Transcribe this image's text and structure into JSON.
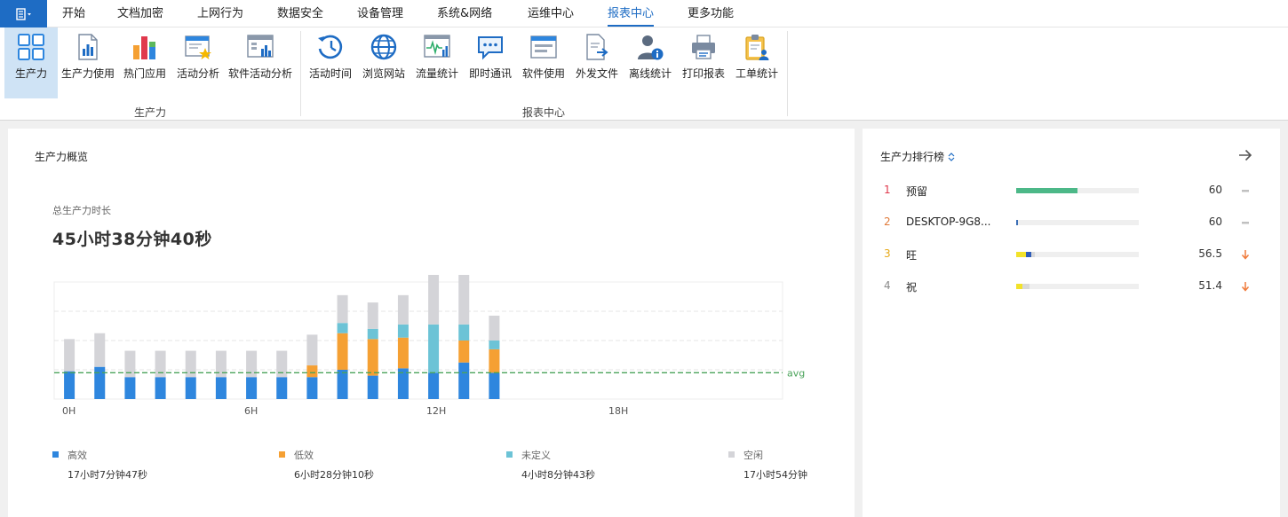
{
  "menu": {
    "items": [
      "开始",
      "文档加密",
      "上网行为",
      "数据安全",
      "设备管理",
      "系统&网络",
      "运维中心",
      "报表中心",
      "更多功能"
    ],
    "active_index": 7
  },
  "ribbon": {
    "groups": [
      {
        "label": "生产力",
        "items": [
          "生产力",
          "生产力使用",
          "热门应用",
          "活动分析",
          "软件活动分析"
        ]
      },
      {
        "label": "报表中心",
        "items": [
          "活动时间",
          "浏览网站",
          "流量统计",
          "即时通讯",
          "软件使用",
          "外发文件",
          "离线统计",
          "打印报表",
          "工单统计"
        ]
      }
    ],
    "selected_item": "生产力"
  },
  "overview": {
    "title": "生产力概览",
    "total_label": "总生产力时长",
    "total_value": "45小时38分钟40秒"
  },
  "chart_data": {
    "type": "bar",
    "stacked": true,
    "x_tick_labels": [
      "0H",
      "6H",
      "12H",
      "18H"
    ],
    "hours": [
      0,
      1,
      2,
      3,
      4,
      5,
      6,
      7,
      8,
      9,
      10,
      11,
      12,
      13,
      14
    ],
    "series": [
      {
        "name": "高效",
        "color": "#2e86de",
        "values": [
          19,
          22,
          15,
          15,
          15,
          15,
          15,
          15,
          15,
          20,
          16,
          21,
          18,
          25,
          18
        ]
      },
      {
        "name": "低效",
        "color": "#f5a033",
        "values": [
          0,
          0,
          0,
          0,
          0,
          0,
          0,
          0,
          8,
          25,
          25,
          21,
          0,
          15,
          16
        ]
      },
      {
        "name": "未定义",
        "color": "#6cc3d6",
        "values": [
          0,
          0,
          0,
          0,
          0,
          0,
          0,
          0,
          0,
          7,
          7,
          9,
          33,
          11,
          6
        ]
      },
      {
        "name": "空闲",
        "color": "#d4d4d8",
        "values": [
          22,
          23,
          18,
          18,
          18,
          18,
          18,
          18,
          21,
          19,
          18,
          20,
          37,
          36,
          17
        ]
      }
    ],
    "avg_label": "avg",
    "avg_value": 18,
    "grid": true
  },
  "legend": [
    {
      "name": "高效",
      "value": "17小时7分钟47秒",
      "color": "#2e86de"
    },
    {
      "name": "低效",
      "value": "6小时28分钟10秒",
      "color": "#f5a033"
    },
    {
      "name": "未定义",
      "value": "4小时8分钟43秒",
      "color": "#6cc3d6"
    },
    {
      "name": "空闲",
      "value": "17小时54分钟",
      "color": "#d4d4d8"
    }
  ],
  "ranking": {
    "title": "生产力排行榜",
    "rows": [
      {
        "rank": "1",
        "rank_color": "#e0384c",
        "name": "预留",
        "score": "60",
        "trend": "flat",
        "bar_segments": [
          {
            "color": "#4cb888",
            "fraction": 0.5
          }
        ]
      },
      {
        "rank": "2",
        "rank_color": "#e07a3a",
        "name": "DESKTOP-9G8...",
        "score": "60",
        "trend": "flat",
        "bar_segments": [
          {
            "color": "#3b6fb6",
            "fraction": 0.015
          }
        ]
      },
      {
        "rank": "3",
        "rank_color": "#e6a817",
        "name": "旺",
        "score": "56.5",
        "trend": "down",
        "bar_segments": [
          {
            "color": "#f2e22a",
            "fraction": 0.08
          },
          {
            "color": "#2f5db8",
            "fraction": 0.04
          },
          {
            "color": "#d9d9d9",
            "fraction": 0.03
          }
        ]
      },
      {
        "rank": "4",
        "rank_color": "#8a8a8a",
        "name": "祝",
        "score": "51.4",
        "trend": "down",
        "bar_segments": [
          {
            "color": "#f2e22a",
            "fraction": 0.05
          },
          {
            "color": "#d9d9d9",
            "fraction": 0.06
          }
        ]
      }
    ]
  },
  "colors": {
    "accent": "#1e6cc4",
    "avg_line": "#4aa35a",
    "trend_down": "#f07a3a",
    "trend_flat": "#c0c0c0"
  }
}
